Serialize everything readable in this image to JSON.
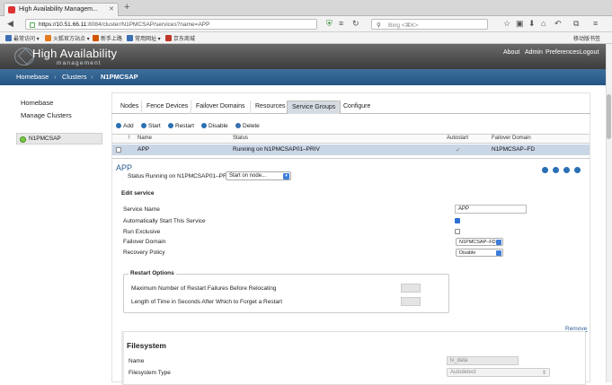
{
  "browser": {
    "tab_title": "High Availability Managem...",
    "url_host": "https://10.51.66.11",
    "url_rest": ":8084/cluster/N1PMCSAP/services?name=APP",
    "search_placeholder": "Bing <⌘K>",
    "bookmarks": [
      "最常访问 ▾",
      "火狐官方站点 ▾",
      "新手上路",
      "常用网址 ▾",
      "京东商城"
    ],
    "mobile_bookmarks": "移动版书签",
    "bookmark_colors": [
      "#3c6fb4",
      "#e57b1e",
      "#d35400",
      "#3c6fb4",
      "#c0392b"
    ]
  },
  "app": {
    "title": "High Availability",
    "subtitle": "management",
    "top_links": [
      "About",
      "Admin",
      "Preferences",
      "Logout"
    ]
  },
  "breadcrumb": {
    "home": "Homebase",
    "sep": "›",
    "clusters": "Clusters",
    "current": "N1PMCSAP"
  },
  "sidebar": {
    "homebase": "Homebase",
    "manage": "Manage Clusters",
    "cluster": "N1PMCSAP"
  },
  "tabs": [
    "Nodes",
    "Fence Devices",
    "Failover Domains",
    "Resources",
    "Service Groups",
    "Configure"
  ],
  "toolbar": {
    "add": "Add",
    "start": "Start",
    "restart": "Restart",
    "disable": "Disable",
    "delete": "Delete"
  },
  "table": {
    "headers": [
      "!",
      "Name",
      "Status",
      "Autostart",
      "Failover Domain"
    ],
    "row": {
      "name": "APP",
      "status": "Running on N1PMCSAP01–PRIV",
      "autostart": "✓",
      "domain": "N1PMCSAP–FD"
    }
  },
  "service": {
    "name": "APP",
    "status_label": "Status",
    "status_value": "Running on N1PMCSAP01–PRIV",
    "start_on": "Start on node...",
    "edit_heading": "Edit service",
    "labels": [
      "Service Name",
      "Automatically Start This Service",
      "Run Exclusive",
      "Failover Domain",
      "Recovery Policy"
    ],
    "service_name_value": "APP",
    "autostart_checked": true,
    "exclusive_checked": false,
    "failover_domain": "N1PMCSAP–FD",
    "recovery_policy": "Disable"
  },
  "restart": {
    "legend": "Restart Options",
    "max_failures": "Maximum Number of Restart Failures Before Relocating",
    "forget_time": "Length of Time in Seconds After Which to Forget a Restart"
  },
  "filesystem": {
    "remove": "Remove",
    "title": "Filesystem",
    "name_label": "Name",
    "name_value": "lv_data",
    "type_label": "Filesystem Type",
    "type_value": "Autodetect"
  },
  "colors": {
    "accent": "#2a5d92",
    "crumbbar": "#245483",
    "selected_row": "#c9d6e6",
    "status_ok": "#7ac943"
  }
}
